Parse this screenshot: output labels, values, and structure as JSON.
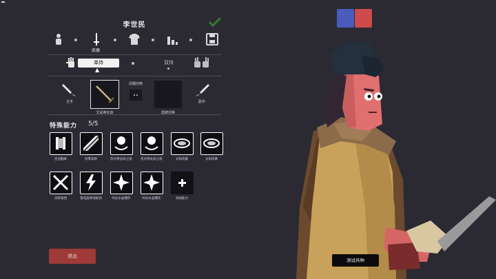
{
  "unit_name": "李世民",
  "nav": {
    "weapon_label": "武器"
  },
  "hand_mode": {
    "single": "单持",
    "dual": "双持"
  },
  "weapons": {
    "main_hand": "主手",
    "off_hand": "副手",
    "main_weapon_name": "文武帝长剑",
    "switch_label": "武器切换",
    "off_weapon_name": "盾牌切换"
  },
  "abilities": {
    "title": "特殊能力",
    "count": "5/5",
    "row1": [
      "连冠翻屏",
      "符箓穿刺",
      "凯尔特女妖之吼",
      "凯尔特女妖之吼",
      "太阳风暴",
      "太阳风暴"
    ],
    "row2": [
      "剑阵格挡",
      "雷电旋转地板毯",
      "时光水晶爆炸",
      "时光水晶爆炸",
      "添加能力"
    ]
  },
  "buttons": {
    "exit": "退出",
    "test": "测试兵种"
  },
  "colors": {
    "team_blue": "#4a5bbd",
    "team_red": "#cf4a4a",
    "exit_bg": "#9e3a38",
    "accent_check": "#2e7d32"
  }
}
